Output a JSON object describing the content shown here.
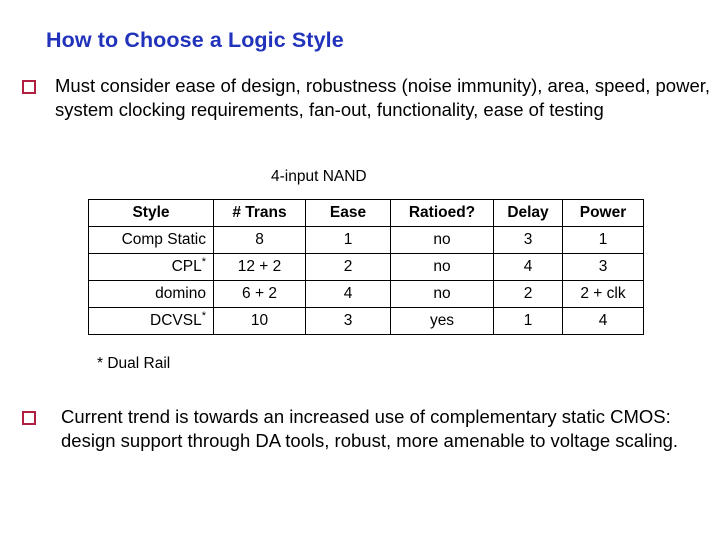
{
  "slide": {
    "title": "How to Choose a Logic Style",
    "title_color": "#2233BB",
    "bullet_marker_color": "#B01F42",
    "background_color": "#FFFFFF"
  },
  "bullets": [
    {
      "marker": "hollow-square-bullet",
      "text": "Must consider ease of design, robustness (noise immunity), area, speed, power, system clocking requirements, fan-out, functionality, ease of testing"
    },
    {
      "marker": "hollow-square-bullet",
      "text": "Current trend is towards an increased use of complementary static CMOS:  design support through DA tools, robust, more amenable to voltage scaling."
    }
  ],
  "table": {
    "caption": "4-input NAND",
    "columns": [
      "Style",
      "# Trans",
      "Ease",
      "Ratioed?",
      "Delay",
      "Power"
    ],
    "rows": [
      {
        "style": "Comp Static",
        "style_star": "",
        "trans": "8",
        "ease": "1",
        "ratioed": "no",
        "delay": "3",
        "power": "1"
      },
      {
        "style": "CPL",
        "style_star": "*",
        "trans": "12 + 2",
        "ease": "2",
        "ratioed": "no",
        "delay": "4",
        "power": "3"
      },
      {
        "style": "domino",
        "style_star": "",
        "trans": "6 + 2",
        "ease": "4",
        "ratioed": "no",
        "delay": "2",
        "power": "2 + clk"
      },
      {
        "style": "DCVSL",
        "style_star": "*",
        "trans": "10",
        "ease": "3",
        "ratioed": "yes",
        "delay": "1",
        "power": "4"
      }
    ],
    "footnote": "* Dual Rail"
  }
}
